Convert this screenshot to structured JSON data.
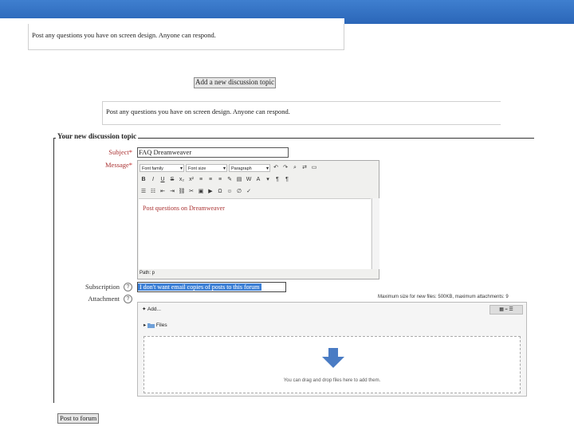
{
  "forum_description": "Post any questions you have on screen design. Anyone can respond.",
  "add_topic_button": "Add a new discussion topic",
  "form": {
    "legend": "Your new discussion topic",
    "subject_label": "Subject",
    "subject_value": "FAQ Dreamweaver",
    "message_label": "Message",
    "required_mark": "*",
    "subscription_label": "Subscription",
    "subscription_value": "I don't want email copies of posts to this forum",
    "attachment_label": "Attachment",
    "help_glyph": "?",
    "max_size_text": "Maximum size for new files: 500KB, maximum attachments: 9",
    "submit_label": "Post to forum"
  },
  "editor": {
    "font_family": "Font family",
    "font_size": "Font size",
    "paragraph": "Paragraph",
    "body_text": "Post questions on Dreamweaver",
    "path_label": "Path: p",
    "icons_row2": [
      "B",
      "I",
      "U",
      "S",
      "x₂",
      "x²"
    ],
    "icons_row3": [
      "☰",
      "☷",
      "Ω"
    ]
  },
  "filepicker": {
    "add_label": "Add...",
    "files_label": "Files",
    "drop_text": "You can drag and drop files here to add them."
  },
  "colors": {
    "topbar": "#2b66b8",
    "required": "#b22222",
    "selection": "#3d80d6",
    "drop_arrow": "#4a7cc4"
  }
}
